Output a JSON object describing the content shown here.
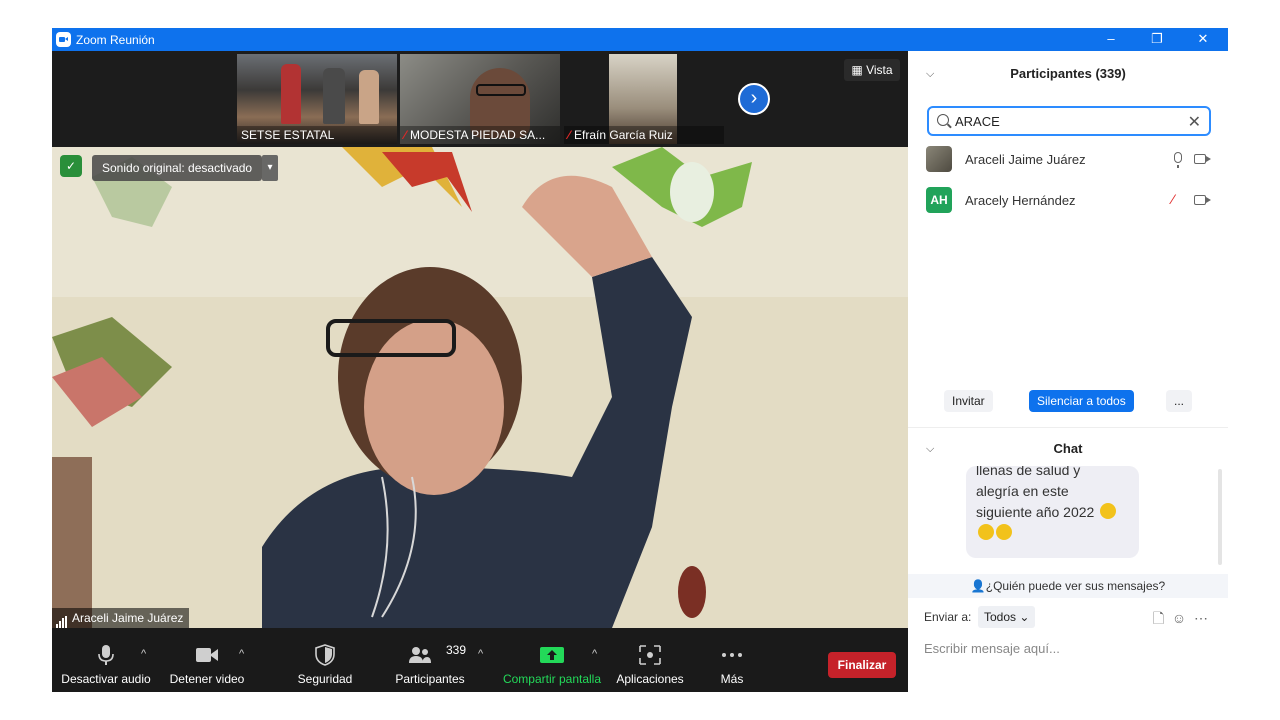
{
  "window": {
    "title": "Zoom Reunión",
    "controls": {
      "minimize": "–",
      "restore": "❐",
      "close": "✕"
    }
  },
  "gallery": {
    "thumbnails": [
      {
        "name": "SETSE ESTATAL",
        "muted": false
      },
      {
        "name": "MODESTA PIEDAD SA...",
        "muted": true
      },
      {
        "name": "Efraín García Ruiz",
        "muted": true
      }
    ],
    "next_label": "›",
    "view_label": "Vista"
  },
  "main_video": {
    "sound_badge": "Sonido original: desactivado",
    "speaker_name": "Araceli Jaime Juárez"
  },
  "toolbar": {
    "mute_label": "Desactivar audio",
    "video_label": "Detener video",
    "security_label": "Seguridad",
    "participants_label": "Participantes",
    "participants_count": "339",
    "share_label": "Compartir pantalla",
    "apps_label": "Aplicaciones",
    "more_label": "Más",
    "end_label": "Finalizar"
  },
  "participants_panel": {
    "title": "Participantes (339)",
    "search_value": "ARACE",
    "items": [
      {
        "name": "Araceli Jaime Juárez",
        "initials": "",
        "muted": false
      },
      {
        "name": "Aracely Hernández",
        "initials": "AH",
        "muted": true
      }
    ],
    "invite_label": "Invitar",
    "mute_all_label": "Silenciar a todos",
    "more_label": "..."
  },
  "chat": {
    "title": "Chat",
    "message_lines": [
      "llenas de salud y",
      "alegría en este",
      "siguiente año 2022"
    ],
    "who_sees": "¿Quién puede ver sus mensajes?",
    "send_to_label": "Enviar a:",
    "send_to_value": "Todos",
    "input_placeholder": "Escribir mensaje aquí..."
  },
  "colors": {
    "titlebar": "#0e72ed",
    "end_button": "#c6222a",
    "share_green": "#23d959",
    "accent_blue": "#0e72ed"
  }
}
